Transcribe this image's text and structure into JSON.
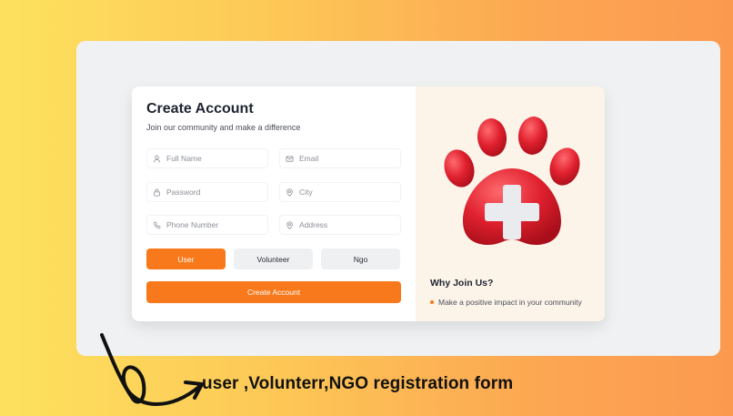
{
  "form": {
    "title": "Create Account",
    "subtitle": "Join our community and make a difference",
    "fields": [
      {
        "placeholder": "Full Name",
        "icon": "user-icon"
      },
      {
        "placeholder": "Email",
        "icon": "mail-icon"
      },
      {
        "placeholder": "Password",
        "icon": "lock-icon"
      },
      {
        "placeholder": "City",
        "icon": "map-pin-icon"
      },
      {
        "placeholder": "Phone Number",
        "icon": "phone-icon"
      },
      {
        "placeholder": "Address",
        "icon": "map-pin-icon"
      }
    ],
    "roles": [
      "User",
      "Volunteer",
      "Ngo"
    ],
    "selected_role": "User",
    "submit_label": "Create Account"
  },
  "aside": {
    "illustration": "paw-medical-cross-icon",
    "heading": "Why Join Us?",
    "benefits": [
      "Make a positive impact in your community"
    ]
  },
  "caption": "user ,Volunterr,NGO registration  form",
  "colors": {
    "accent": "#f7791b",
    "paw_red": "#e0202e",
    "aside_bg": "#fdf4e9"
  }
}
